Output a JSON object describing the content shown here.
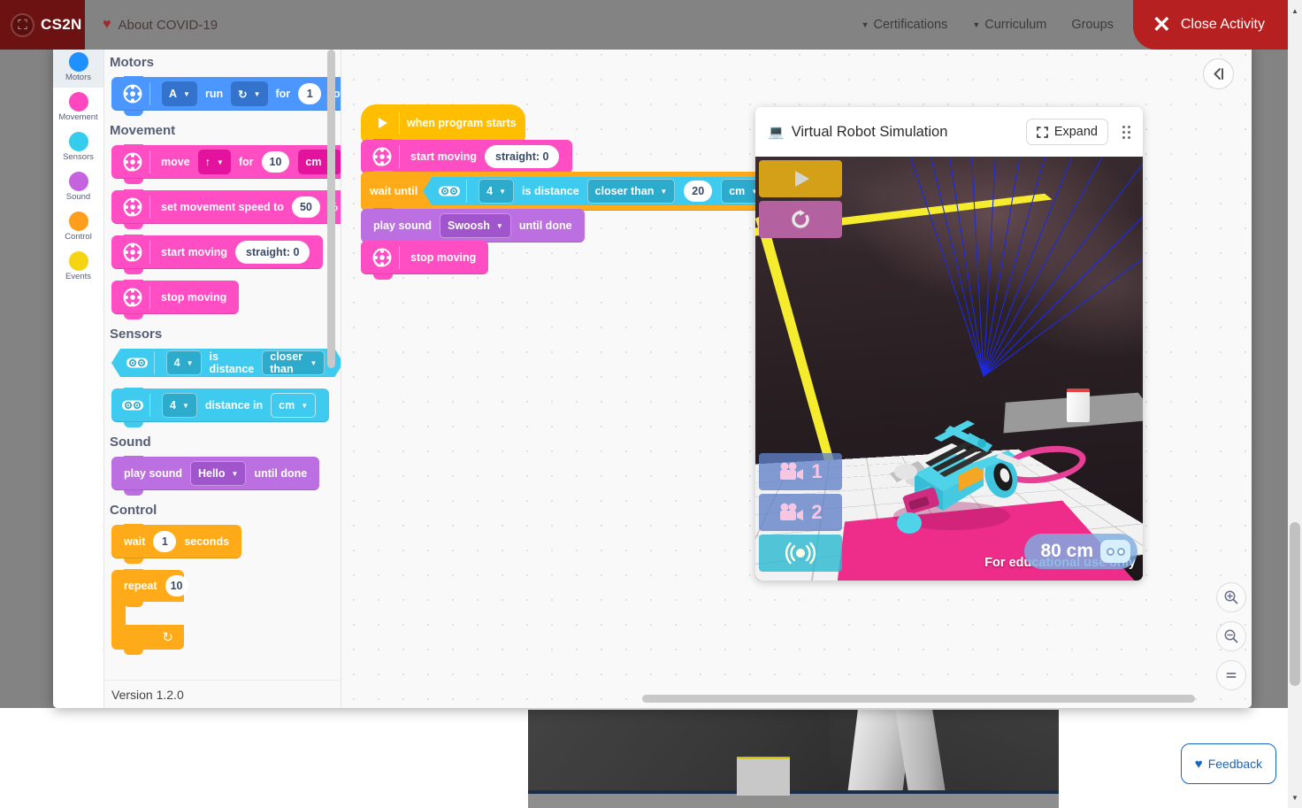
{
  "topnav": {
    "brand": "CS2N",
    "brand_logo_icon": "castle-logo-icon",
    "covid_link": "About COVID-19",
    "items": [
      {
        "label": "Certifications",
        "has_caret": true
      },
      {
        "label": "Curriculum",
        "has_caret": true
      },
      {
        "label": "Groups",
        "has_caret": false
      }
    ],
    "close_activity": "Close Activity",
    "accent_red": "#b62020",
    "brand_red": "#6d1212"
  },
  "background": {
    "feedback_label": "Feedback"
  },
  "categories": [
    {
      "label": "Motors",
      "color": "#1e90ff",
      "active": true
    },
    {
      "label": "Movement",
      "color": "#ff47c0",
      "active": false
    },
    {
      "label": "Sensors",
      "color": "#34cdee",
      "active": false
    },
    {
      "label": "Sound",
      "color": "#c462e0",
      "active": false
    },
    {
      "label": "Control",
      "color": "#ff9e1b",
      "active": false
    },
    {
      "label": "Events",
      "color": "#f5d512",
      "active": false
    }
  ],
  "palette": {
    "version": "Version 1.2.0",
    "sections": [
      {
        "heading": "Motors",
        "blocks": [
          {
            "kind": "motors",
            "icon": "motor-icon",
            "parts": [
              {
                "t": "drop",
                "v": "A",
                "style": "dk-motors"
              },
              {
                "t": "text",
                "v": "run"
              },
              {
                "t": "drop",
                "v": "↻",
                "style": "dk-motors"
              },
              {
                "t": "text",
                "v": "for"
              },
              {
                "t": "round",
                "v": "1"
              },
              {
                "t": "text",
                "v": "rot"
              }
            ]
          }
        ]
      },
      {
        "heading": "Movement",
        "blocks": [
          {
            "kind": "movement",
            "icon": "drivetrain-icon",
            "parts": [
              {
                "t": "text",
                "v": "move"
              },
              {
                "t": "drop",
                "v": "↑",
                "style": "dk-movement"
              },
              {
                "t": "text",
                "v": "for"
              },
              {
                "t": "round",
                "v": "10"
              },
              {
                "t": "drop",
                "v": "cm",
                "style": "dk-movement"
              }
            ]
          },
          {
            "kind": "movement",
            "icon": "drivetrain-icon",
            "parts": [
              {
                "t": "text",
                "v": "set movement speed to"
              },
              {
                "t": "round",
                "v": "50"
              },
              {
                "t": "text",
                "v": "%"
              }
            ]
          },
          {
            "kind": "movement",
            "icon": "drivetrain-icon",
            "parts": [
              {
                "t": "text",
                "v": "start moving"
              },
              {
                "t": "pill",
                "v": "straight: 0"
              }
            ]
          },
          {
            "kind": "movement",
            "icon": "drivetrain-icon",
            "parts": [
              {
                "t": "text",
                "v": "stop moving"
              }
            ]
          }
        ]
      },
      {
        "heading": "Sensors",
        "blocks": [
          {
            "kind": "sensors-bool",
            "icon": "ultrasonic-icon",
            "parts": [
              {
                "t": "drop",
                "v": "4",
                "style": "dk-sensors"
              },
              {
                "t": "text",
                "v": "is distance"
              },
              {
                "t": "drop",
                "v": "closer than",
                "style": "dk-sensors"
              }
            ]
          },
          {
            "kind": "sensors",
            "icon": "ultrasonic-icon",
            "parts": [
              {
                "t": "drop",
                "v": "4",
                "style": "dk-sensors"
              },
              {
                "t": "text",
                "v": "distance in"
              },
              {
                "t": "drop",
                "v": "cm",
                "style": "lt-sensors"
              }
            ]
          }
        ]
      },
      {
        "heading": "Sound",
        "blocks": [
          {
            "kind": "sound",
            "icon": "",
            "parts": [
              {
                "t": "text",
                "v": "play sound"
              },
              {
                "t": "drop",
                "v": "Hello",
                "style": "dk-sound"
              },
              {
                "t": "text",
                "v": "until done"
              }
            ]
          }
        ]
      },
      {
        "heading": "Control",
        "blocks": [
          {
            "kind": "control",
            "icon": "",
            "parts": [
              {
                "t": "text",
                "v": "wait"
              },
              {
                "t": "round",
                "v": "1"
              },
              {
                "t": "text",
                "v": "seconds"
              }
            ]
          },
          {
            "kind": "control-c",
            "icon": "",
            "parts": [
              {
                "t": "text",
                "v": "repeat"
              },
              {
                "t": "round",
                "v": "10"
              }
            ],
            "loop_arrow": "↻"
          }
        ]
      }
    ]
  },
  "script": {
    "blocks": [
      {
        "kind": "events-hat",
        "icon": "play-flag-icon",
        "label": "when program starts"
      },
      {
        "kind": "movement",
        "icon": "drivetrain-icon",
        "parts": [
          {
            "t": "text",
            "v": "start moving"
          },
          {
            "t": "pill",
            "v": "straight: 0"
          }
        ]
      },
      {
        "kind": "control-wait-until",
        "label": "wait until",
        "condition": {
          "icon": "ultrasonic-icon",
          "parts": [
            {
              "t": "drop",
              "v": "4",
              "style": "dk-sensors"
            },
            {
              "t": "text",
              "v": "is distance"
            },
            {
              "t": "drop",
              "v": "closer than",
              "style": "dk-sensors"
            },
            {
              "t": "round",
              "v": "20"
            },
            {
              "t": "drop",
              "v": "cm",
              "style": "dk-sensors"
            }
          ]
        },
        "suffix": "?"
      },
      {
        "kind": "sound",
        "icon": "",
        "parts": [
          {
            "t": "text",
            "v": "play sound"
          },
          {
            "t": "drop",
            "v": "Swoosh",
            "style": "dk-sound"
          },
          {
            "t": "text",
            "v": "until done"
          }
        ]
      },
      {
        "kind": "movement",
        "icon": "drivetrain-icon",
        "parts": [
          {
            "t": "text",
            "v": "stop moving"
          }
        ]
      }
    ]
  },
  "workspace": {
    "collapse_icon": "collapse-left-icon"
  },
  "simulation": {
    "title": "Virtual Robot Simulation",
    "title_icon": "monitor-icon",
    "expand_label": "Expand",
    "expand_icon": "expand-frame-icon",
    "grip_icon": "drag-grip-icon",
    "run_icon": "play-icon",
    "reset_icon": "reset-icon",
    "camera_buttons": [
      {
        "label": "1",
        "icon": "camera-icon"
      },
      {
        "label": "2",
        "icon": "camera-icon"
      }
    ],
    "sonic_button": {
      "label": "",
      "icon": "ultrasonic-wave-icon"
    },
    "distance_readout": "80 cm",
    "distance_icon": "ultrasonic-sensor-icon",
    "watermark": "For educational use only",
    "zoom_controls": [
      {
        "name": "zoom-in",
        "glyph": "+"
      },
      {
        "name": "zoom-out",
        "glyph": "−"
      },
      {
        "name": "zoom-reset",
        "glyph": "="
      }
    ]
  }
}
